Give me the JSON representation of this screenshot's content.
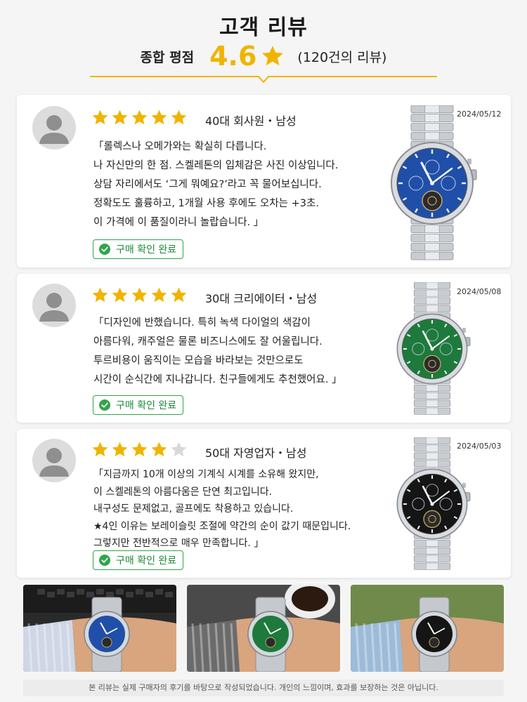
{
  "header": {
    "title": "고객 리뷰",
    "summary_label": "종합 평점",
    "score": "4.6",
    "review_count": "(120건의 리뷰)",
    "accent_color": "#f0b400"
  },
  "reviews": [
    {
      "rating": 5,
      "reviewer": "40대 회사원・남성",
      "date": "2024/05/12",
      "lines": [
        "「롤렉스나 오메가와는 확실히 다릅니다.",
        "나 자신만의 한 점. 스켈레톤의 입체감은 사진 이상입니다.",
        "상담 자리에서도 ‘그게 뭐예요?’라고 꼭 물어보십니다.",
        "정확도도 훌륭하고,  1개월 사용 후에도 오차는 +3초.",
        "이 가격에 이 품질이라니 놀랍습니다. 」"
      ],
      "badge": "구매 확인 완료",
      "dial_color": "#1f4fa8"
    },
    {
      "rating": 5,
      "reviewer": "30대 크리에이터・남성",
      "date": "2024/05/08",
      "lines": [
        "「디자인에 반했습니다. 특히 녹색 다이얼의 색감이",
        "아름다워, 캐주얼은 물론 비즈니스에도 잘 어울립니다.",
        "투르비용이 움직이는 모습을 바라보는 것만으로도",
        "시간이 순식간에 지나갑니다. 친구들에게도 추천했어요. 」"
      ],
      "badge": "구매 확인 완료",
      "dial_color": "#1d7a3c"
    },
    {
      "rating": 4,
      "reviewer": "50대 자영업자・남성",
      "date": "2024/05/03",
      "lines": [
        "「지금까지 10개 이상의 기계식 시계를 소유해 왔지만,",
        "이 스켈레톤의 아름다움은 단연 최고입니다.",
        "내구성도 문제없고, 골프에도 착용하고 있습니다.",
        "★4인 이유는 보레이슬릿 조절에 약간의 순이 값기 때문입니다.",
        "그렇지만 전반적으로 매우 만족합니다. 」"
      ],
      "badge": "구매 확인 완료",
      "dial_color": "#151515"
    }
  ],
  "photos": [
    {
      "name": "blue-watch-wrist-photo",
      "dial_color": "#1f4fa8"
    },
    {
      "name": "green-watch-wrist-photo",
      "dial_color": "#1d7a3c"
    },
    {
      "name": "black-watch-wrist-photo",
      "dial_color": "#151515"
    }
  ],
  "footer": {
    "disclaimer": "본 리뷰는 실제 구매자의 후기를 바탕으로 작성되었습니다. 개인의 느낌이며, 효과를 보장하는 것은 아닙니다."
  },
  "colors": {
    "star_filled": "#f0b400",
    "star_empty": "#d8d8d8",
    "verified_green": "#2fa64a"
  }
}
